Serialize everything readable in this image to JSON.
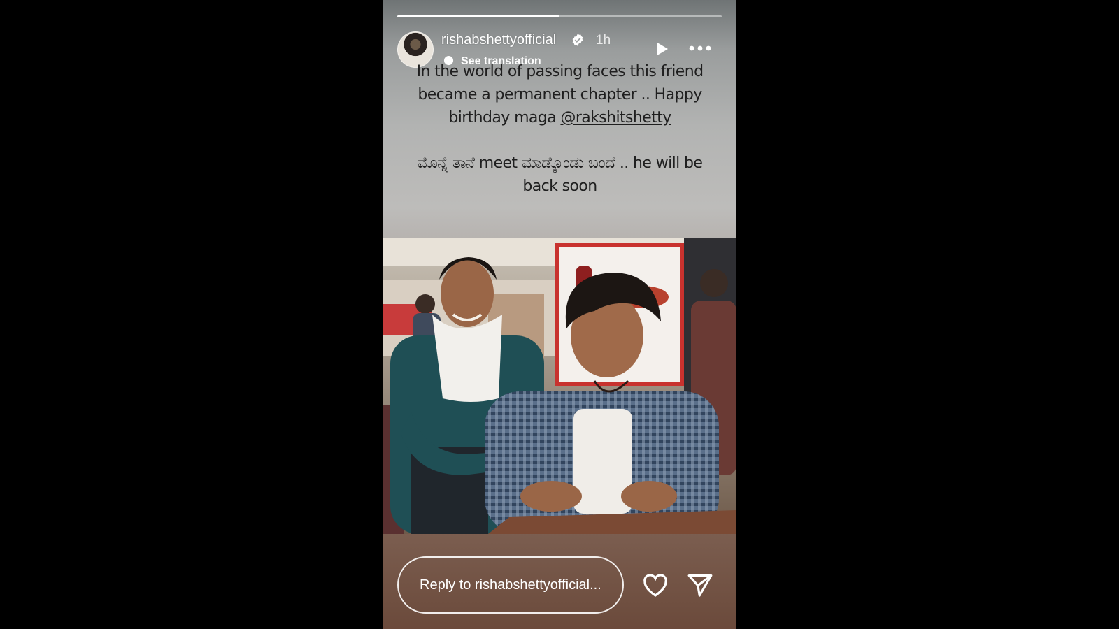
{
  "story": {
    "progress": 0.5,
    "username": "rishabshettyofficial",
    "time": "1h",
    "see_translation": "See translation",
    "caption_line1": "In the world of passing faces this friend became a permanent chapter .. Happy birthday maga ",
    "mention": "@rakshitshetty",
    "caption_line2": "ಮೊನ್ನೆ ತಾನೆ meet ಮಾಡ್ಕೊಂಡು ಬಂದೆ .. he will be back soon",
    "reply_placeholder": "Reply to rishabshettyofficial...",
    "icons": {
      "verified": "verified-badge-icon",
      "play": "play-icon",
      "more": "more-options-icon",
      "translate": "translate-icon",
      "like": "heart-icon",
      "share": "send-icon"
    }
  }
}
